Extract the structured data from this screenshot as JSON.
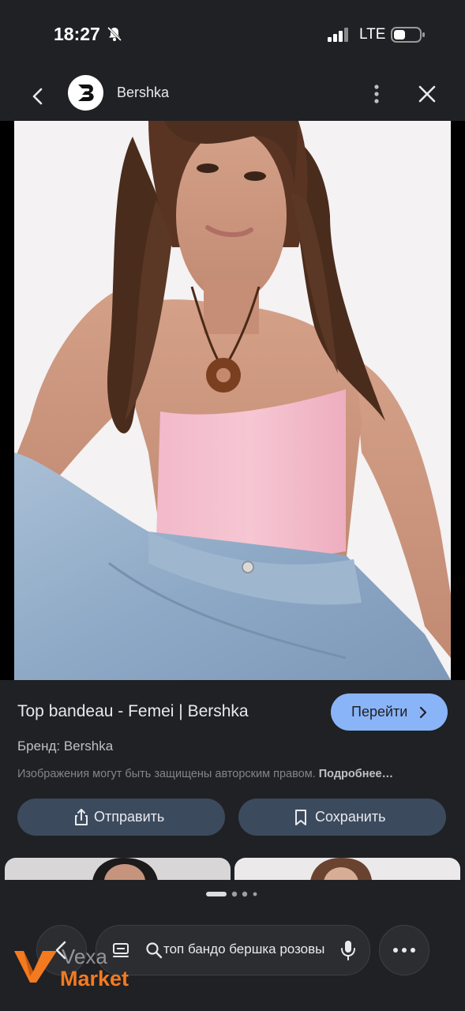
{
  "status_bar": {
    "time": "18:27",
    "network": "LTE",
    "icons": [
      "bell-off-icon",
      "signal-icon",
      "battery-icon"
    ]
  },
  "header": {
    "site_name": "Bershka",
    "logo_letter": "B",
    "icons": [
      "back-arrow-icon",
      "more-vert-icon",
      "close-icon"
    ]
  },
  "result": {
    "title": "Top bandeau - Femei | Bershka",
    "visit_label": "Перейти",
    "brand_line": "Бренд: Bershka",
    "copyright_text": "Изображения могут быть защищены авторским правом.",
    "copyright_link": "Подробнее…",
    "share_label": "Отправить",
    "save_label": "Сохранить"
  },
  "bottom_bar": {
    "search_query": "топ  бандо бершка розовый",
    "icons": [
      "back-arrow-icon",
      "tabs-icon",
      "search-icon",
      "mic-icon",
      "more-horiz-icon"
    ]
  },
  "watermark": {
    "line1": "Vexa",
    "line2": "Market"
  },
  "colors": {
    "background": "#202124",
    "accent_button": "#8ab4f8",
    "secondary_button": "#3c4a5e",
    "watermark_orange": "#f47a20"
  }
}
